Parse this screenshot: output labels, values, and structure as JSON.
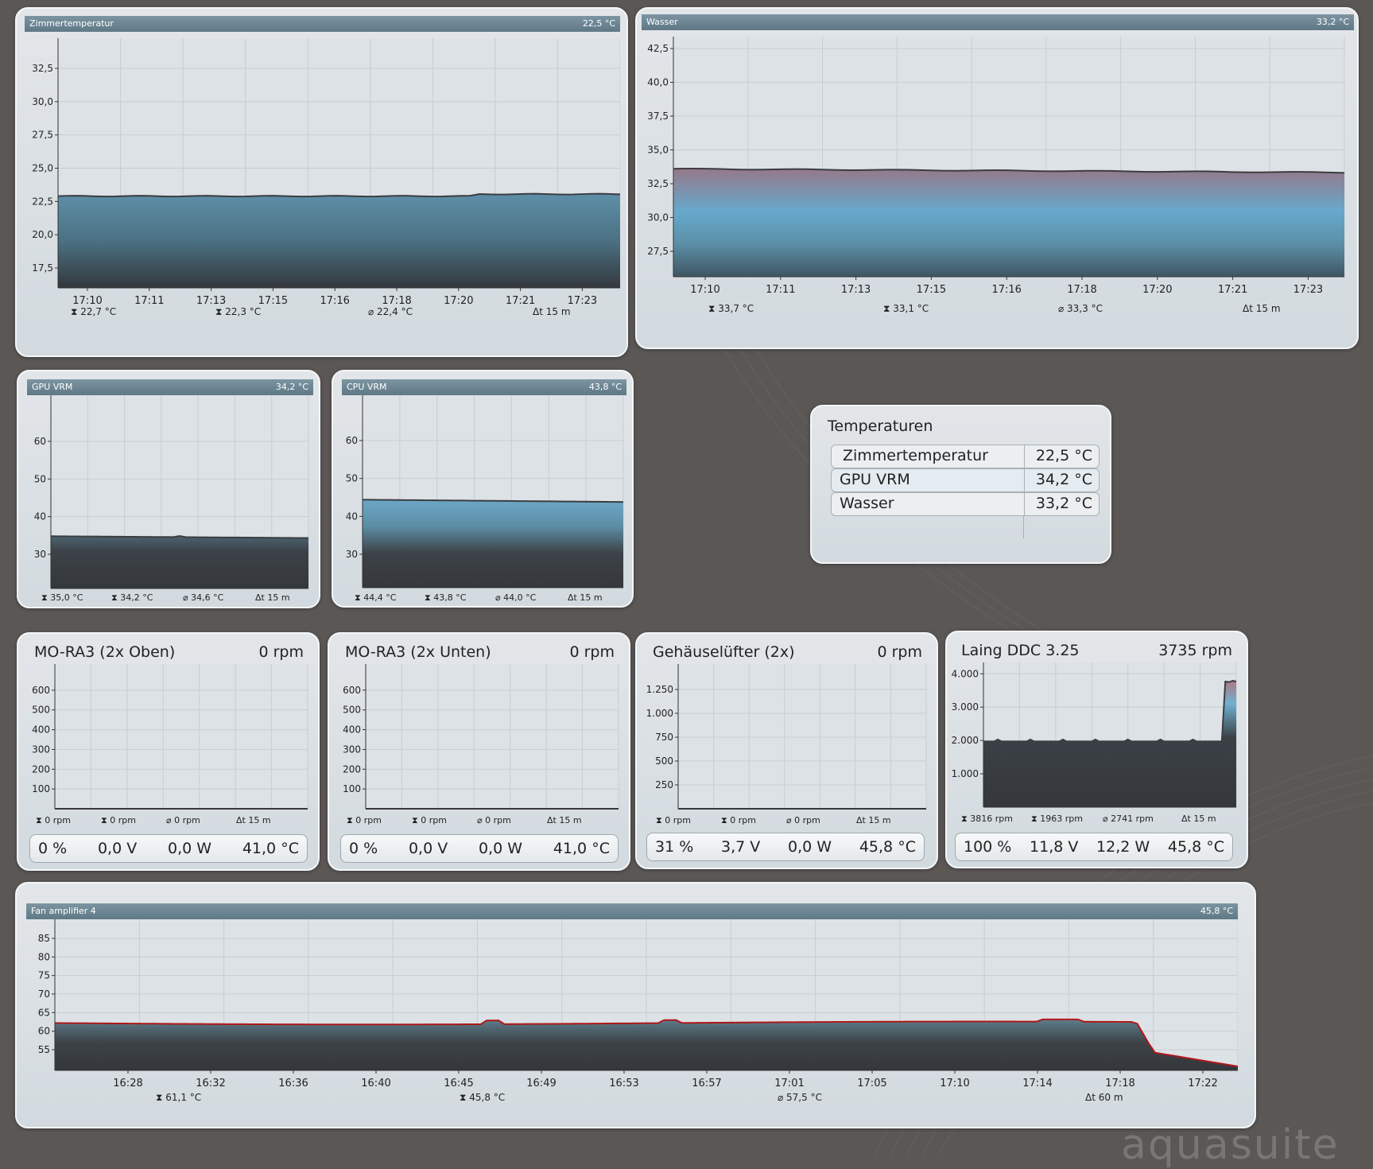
{
  "brand": "aquasuite",
  "colors": {
    "background": "#5a5755",
    "panel": "#dfe3e6",
    "header": "#6d8592",
    "line_dark": "#3b3d40",
    "line_red": "#b01818"
  },
  "charts": [
    {
      "id": "zimmer",
      "title": "Zimmertemperatur",
      "value": "22,5 °C",
      "yticks": [
        "32,5",
        "30,0",
        "27,5",
        "25,0",
        "22,5",
        "20,0",
        "17,5"
      ],
      "xticks": [
        "17:10",
        "17:11",
        "17:13",
        "17:15",
        "17:16",
        "17:18",
        "17:20",
        "17:21",
        "17:23"
      ],
      "stats": {
        "max": "22,7 °C",
        "min": "22,3 °C",
        "avg": "22,4 °C",
        "span": "15 m"
      }
    },
    {
      "id": "wasser",
      "title": "Wasser",
      "value": "33,2 °C",
      "yticks": [
        "42,5",
        "40,0",
        "37,5",
        "35,0",
        "32,5",
        "30,0",
        "27,5"
      ],
      "xticks": [
        "17:10",
        "17:11",
        "17:13",
        "17:15",
        "17:16",
        "17:18",
        "17:20",
        "17:21",
        "17:23"
      ],
      "stats": {
        "max": "33,7 °C",
        "min": "33,1 °C",
        "avg": "33,3 °C",
        "span": "15 m"
      }
    },
    {
      "id": "gpuvrm",
      "title": "GPU VRM",
      "value": "34,2 °C",
      "yticks": [
        "60",
        "50",
        "40",
        "30"
      ],
      "stats": {
        "max": "35,0 °C",
        "min": "34,2 °C",
        "avg": "34,6 °C",
        "span": "15 m"
      }
    },
    {
      "id": "cpuvrm",
      "title": "CPU VRM",
      "value": "43,8 °C",
      "yticks": [
        "60",
        "50",
        "40",
        "30"
      ],
      "stats": {
        "max": "44,4 °C",
        "min": "43,8 °C",
        "avg": "44,0 °C",
        "span": "15 m"
      }
    },
    {
      "id": "fanamp",
      "title": "Fan amplifier 4",
      "value": "45,8 °C",
      "yticks": [
        "85",
        "80",
        "75",
        "70",
        "65",
        "60",
        "55"
      ],
      "xticks": [
        "16:28",
        "16:32",
        "16:36",
        "16:40",
        "16:45",
        "16:49",
        "16:53",
        "16:57",
        "17:01",
        "17:05",
        "17:10",
        "17:14",
        "17:18",
        "17:22"
      ],
      "stats": {
        "max": "61,1 °C",
        "min": "45,8 °C",
        "avg": "57,5 °C",
        "span": "60 m"
      }
    }
  ],
  "temperatures": {
    "title": "Temperaturen",
    "rows": [
      {
        "name": "Zimmertemperatur",
        "value": "22,5 °C"
      },
      {
        "name": "GPU VRM",
        "value": "34,2 °C"
      },
      {
        "name": "Wasser",
        "value": "33,2 °C"
      }
    ]
  },
  "fans": [
    {
      "id": "mora_oben",
      "title": "MO-RA3 (2x Oben)",
      "rpm": "0 rpm",
      "yticks": [
        "600",
        "500",
        "400",
        "300",
        "200",
        "100"
      ],
      "stats": {
        "max": "0 rpm",
        "min": "0 rpm",
        "avg": "0 rpm",
        "span": "15 m"
      },
      "readout": {
        "percent": "0 %",
        "voltage": "0,0 V",
        "power": "0,0 W",
        "temp": "41,0 °C"
      }
    },
    {
      "id": "mora_unten",
      "title": "MO-RA3 (2x Unten)",
      "rpm": "0 rpm",
      "yticks": [
        "600",
        "500",
        "400",
        "300",
        "200",
        "100"
      ],
      "stats": {
        "max": "0 rpm",
        "min": "0 rpm",
        "avg": "0 rpm",
        "span": "15 m"
      },
      "readout": {
        "percent": "0 %",
        "voltage": "0,0 V",
        "power": "0,0 W",
        "temp": "41,0 °C"
      }
    },
    {
      "id": "gehause",
      "title": "Gehäuselüfter (2x)",
      "rpm": "0 rpm",
      "yticks": [
        "1.250",
        "1.000",
        "750",
        "500",
        "250"
      ],
      "stats": {
        "max": "0 rpm",
        "min": "0 rpm",
        "avg": "0 rpm",
        "span": "15 m"
      },
      "readout": {
        "percent": "31 %",
        "voltage": "3,7 V",
        "power": "0,0 W",
        "temp": "45,8 °C"
      }
    },
    {
      "id": "laing",
      "title": "Laing DDC 3.25",
      "rpm": "3735 rpm",
      "yticks": [
        "4.000",
        "3.000",
        "2.000",
        "1.000"
      ],
      "stats": {
        "max": "3816 rpm",
        "min": "1963 rpm",
        "avg": "2741 rpm",
        "span": "15 m"
      },
      "readout": {
        "percent": "100 %",
        "voltage": "11,8 V",
        "power": "12,2 W",
        "temp": "45,8 °C"
      }
    }
  ]
}
